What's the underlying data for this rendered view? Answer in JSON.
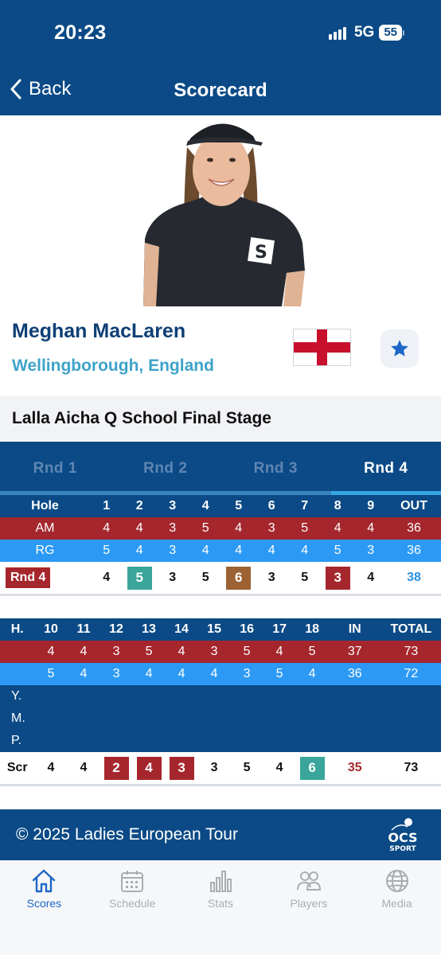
{
  "status": {
    "time": "20:23",
    "network": "5G",
    "battery": "55"
  },
  "header": {
    "back_label": "Back",
    "title": "Scorecard"
  },
  "player": {
    "name": "Meghan MacLaren",
    "location": "Wellingborough, England"
  },
  "event": {
    "name": "Lalla Aicha Q School Final Stage"
  },
  "tabs": [
    "Rnd 1",
    "Rnd 2",
    "Rnd 3",
    "Rnd 4"
  ],
  "active_tab": 3,
  "front": {
    "header": {
      "label": "Hole",
      "holes": [
        "1",
        "2",
        "3",
        "4",
        "5",
        "6",
        "7",
        "8",
        "9"
      ],
      "total": "OUT"
    },
    "am": {
      "label": "AM",
      "values": [
        "4",
        "4",
        "3",
        "5",
        "4",
        "3",
        "5",
        "4",
        "4"
      ],
      "total": "36"
    },
    "rg": {
      "label": "RG",
      "values": [
        "5",
        "4",
        "3",
        "4",
        "4",
        "4",
        "4",
        "5",
        "3"
      ],
      "total": "36"
    },
    "score": {
      "label": "Rnd 4",
      "values": [
        "4",
        "5",
        "3",
        "5",
        "6",
        "3",
        "5",
        "3",
        "4"
      ],
      "total": "38"
    }
  },
  "back": {
    "header": {
      "label": "H.",
      "holes": [
        "10",
        "11",
        "12",
        "13",
        "14",
        "15",
        "16",
        "17",
        "18"
      ],
      "in": "IN",
      "total": "TOTAL"
    },
    "am": {
      "values": [
        "4",
        "4",
        "3",
        "5",
        "4",
        "3",
        "5",
        "4",
        "5"
      ],
      "in": "37",
      "total": "73"
    },
    "rg": {
      "values": [
        "5",
        "4",
        "3",
        "4",
        "4",
        "4",
        "3",
        "5",
        "4"
      ],
      "in": "36",
      "total": "72"
    },
    "y": {
      "label": "Y."
    },
    "m": {
      "label": "M."
    },
    "p": {
      "label": "P."
    },
    "score": {
      "label": "Scr",
      "values": [
        "4",
        "4",
        "2",
        "4",
        "3",
        "3",
        "5",
        "4",
        "6"
      ],
      "in": "35",
      "total": "73"
    }
  },
  "footer": {
    "copyright": "© 2025 Ladies European Tour",
    "logo_text_top": "OCS",
    "logo_text_bottom": "SPORT"
  },
  "nav": [
    {
      "label": "Scores",
      "icon": "home-icon"
    },
    {
      "label": "Schedule",
      "icon": "calendar-icon"
    },
    {
      "label": "Stats",
      "icon": "bar-chart-icon"
    },
    {
      "label": "Players",
      "icon": "people-icon"
    },
    {
      "label": "Media",
      "icon": "globe-icon"
    }
  ],
  "colors": {
    "primary": "#0b4a86",
    "am_row": "#a5272d",
    "rg_row": "#2c9af5",
    "birdie": "#3aa59a",
    "bogey": "#a5272d",
    "double_bogey": "#9c6233",
    "nav_active": "#1e66c7"
  }
}
